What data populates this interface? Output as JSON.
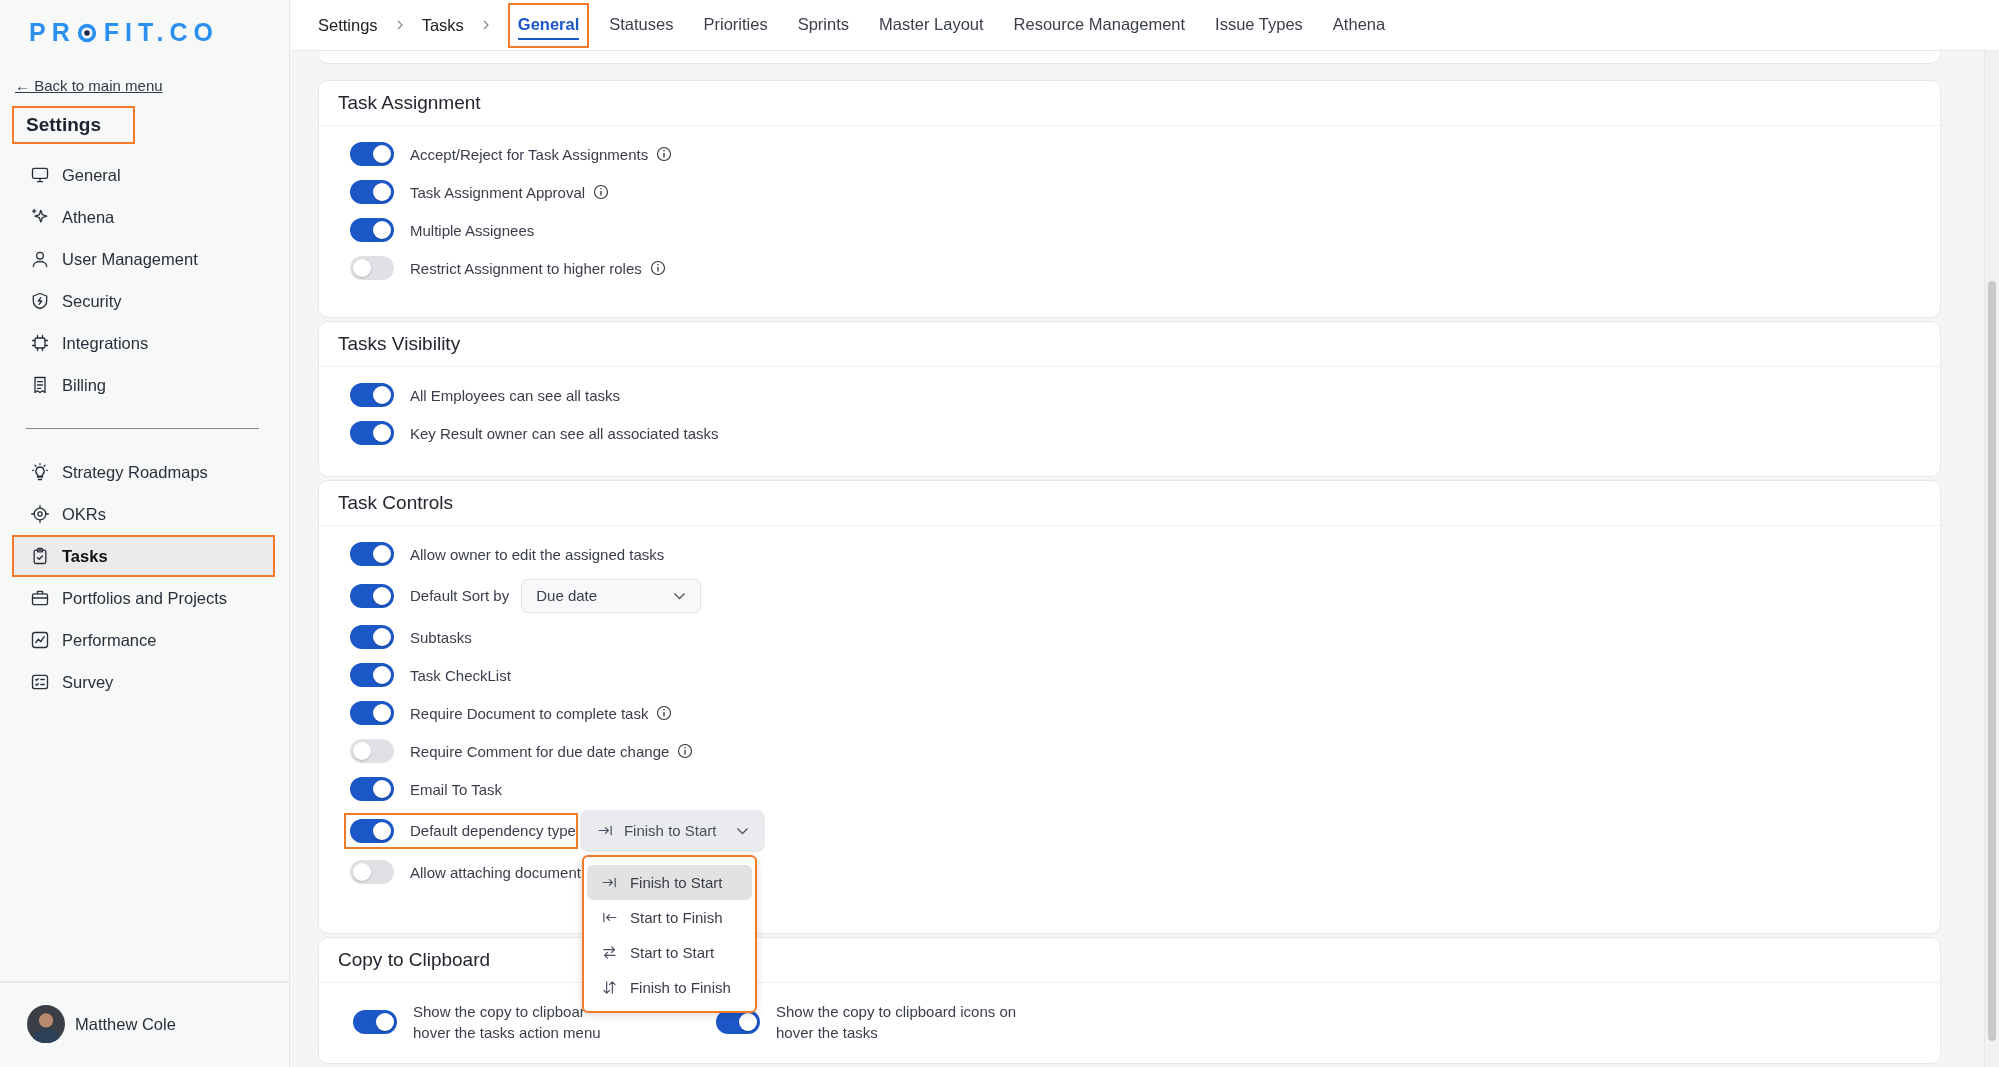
{
  "logo": {
    "parts": [
      "PR",
      "FIT.CO"
    ]
  },
  "sidebar": {
    "back_link": "← Back to main menu",
    "title": "Settings",
    "title_highlighted": true,
    "groups": [
      {
        "items": [
          {
            "label": "General",
            "selected": false,
            "highlighted": false
          },
          {
            "label": "Athena",
            "selected": false,
            "highlighted": false
          },
          {
            "label": "User Management",
            "selected": false,
            "highlighted": false
          },
          {
            "label": "Security",
            "selected": false,
            "highlighted": false
          },
          {
            "label": "Integrations",
            "selected": false,
            "highlighted": false
          },
          {
            "label": "Billing",
            "selected": false,
            "highlighted": false
          }
        ]
      },
      {
        "items": [
          {
            "label": "Strategy Roadmaps",
            "selected": false,
            "highlighted": false
          },
          {
            "label": "OKRs",
            "selected": false,
            "highlighted": false
          },
          {
            "label": "Tasks",
            "selected": true,
            "highlighted": true
          },
          {
            "label": "Portfolios and Projects",
            "selected": false,
            "highlighted": false
          },
          {
            "label": "Performance",
            "selected": false,
            "highlighted": false
          },
          {
            "label": "Survey",
            "selected": false,
            "highlighted": false
          }
        ]
      }
    ],
    "user": {
      "name": "Matthew Cole"
    }
  },
  "breadcrumb": [
    "Settings",
    "Tasks"
  ],
  "tabs": [
    {
      "label": "General",
      "selected": true,
      "highlighted": true
    },
    {
      "label": "Statuses",
      "selected": false,
      "highlighted": false
    },
    {
      "label": "Priorities",
      "selected": false,
      "highlighted": false
    },
    {
      "label": "Sprints",
      "selected": false,
      "highlighted": false
    },
    {
      "label": "Master Layout",
      "selected": false,
      "highlighted": false
    },
    {
      "label": "Resource Management",
      "selected": false,
      "highlighted": false
    },
    {
      "label": "Issue Types",
      "selected": false,
      "highlighted": false
    },
    {
      "label": "Athena",
      "selected": false,
      "highlighted": false
    }
  ],
  "sections": [
    {
      "title": "Task Assignment",
      "kind": "list",
      "rows": [
        {
          "kind": "toggle",
          "label": "Accept/Reject for Task Assignments",
          "on": true,
          "info": true
        },
        {
          "kind": "toggle",
          "label": "Task Assignment Approval",
          "on": true,
          "info": true
        },
        {
          "kind": "toggle",
          "label": "Multiple Assignees",
          "on": true,
          "info": false
        },
        {
          "kind": "toggle",
          "label": "Restrict Assignment to higher roles",
          "on": false,
          "info": true
        }
      ]
    },
    {
      "title": "Tasks Visibility",
      "kind": "list",
      "rows": [
        {
          "kind": "toggle",
          "label": "All Employees can see all tasks",
          "on": true,
          "info": false
        },
        {
          "kind": "toggle",
          "label": "Key Result owner can see all associated tasks",
          "on": true,
          "info": false
        }
      ]
    },
    {
      "title": "Task Controls",
      "kind": "list",
      "rows": [
        {
          "kind": "toggle",
          "label": "Allow owner to edit the assigned tasks",
          "on": true,
          "info": false
        },
        {
          "kind": "select",
          "label": "Default Sort by",
          "on": true,
          "info": false,
          "select": {
            "value": "Due date"
          }
        },
        {
          "kind": "toggle",
          "label": "Subtasks",
          "on": true,
          "info": false
        },
        {
          "kind": "toggle",
          "label": "Task CheckList",
          "on": true,
          "info": false
        },
        {
          "kind": "toggle",
          "label": "Require Document to complete task",
          "on": true,
          "info": true
        },
        {
          "kind": "toggle",
          "label": "Require Comment for due date change",
          "on": false,
          "info": true
        },
        {
          "kind": "toggle",
          "label": "Email To Task",
          "on": true,
          "info": false
        },
        {
          "kind": "dropdown",
          "label": "Default dependency type",
          "on": true,
          "info": false,
          "highlighted": true,
          "select": {
            "value": "Finish to Start"
          },
          "menu": {
            "highlighted": true,
            "options": [
              {
                "label": "Finish to Start",
                "selected": true
              },
              {
                "label": "Start to Finish",
                "selected": false
              },
              {
                "label": "Start to Start",
                "selected": false
              },
              {
                "label": "Finish to Finish",
                "selected": false
              }
            ]
          }
        },
        {
          "kind": "toggle",
          "label": "Allow attaching document",
          "on": false,
          "info": false
        }
      ]
    },
    {
      "title": "Copy to Clipboard",
      "kind": "side_by_side",
      "rows": [
        {
          "kind": "toggle",
          "label": "Show the copy to clipboar\nhover the tasks action menu",
          "on": true,
          "info": false
        },
        {
          "kind": "toggle",
          "label": "Show the copy to clipboard icons on\nhover the tasks",
          "on": true,
          "info": false
        }
      ]
    }
  ]
}
